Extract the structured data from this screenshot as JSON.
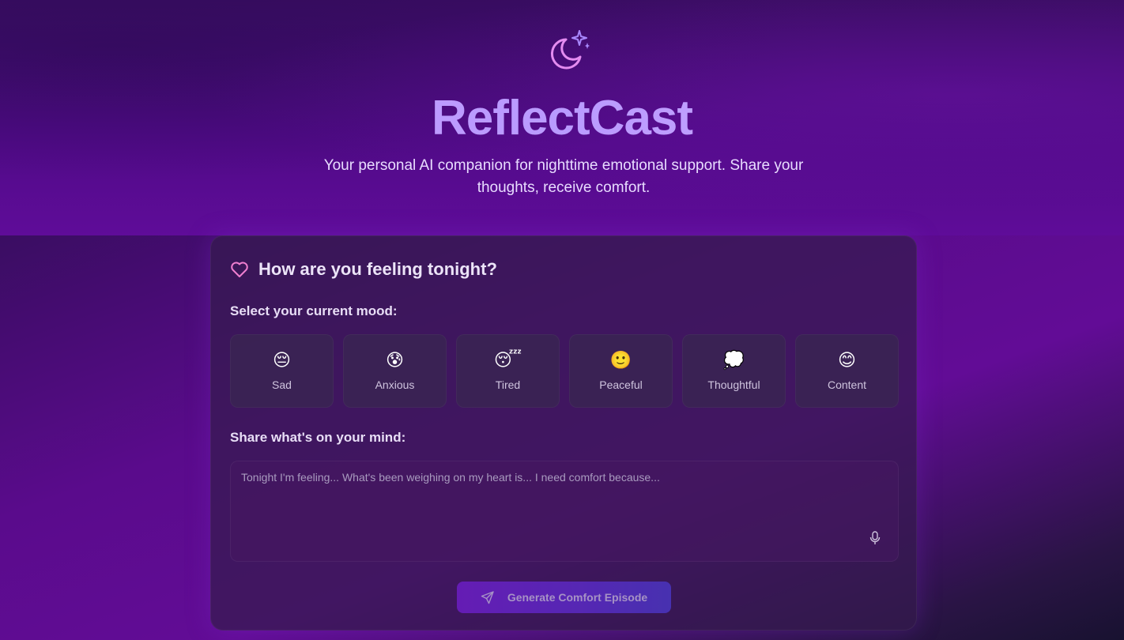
{
  "app": {
    "title": "ReflectCast",
    "subtitle": "Your personal AI companion for nighttime emotional support. Share your thoughts, receive comfort."
  },
  "card": {
    "title": "How are you feeling tonight?",
    "mood_label": "Select your current mood:",
    "moods": [
      {
        "emoji": "😔",
        "label": "Sad"
      },
      {
        "emoji": "😰",
        "label": "Anxious"
      },
      {
        "emoji": "😴",
        "label": "Tired"
      },
      {
        "emoji": "🙂",
        "label": "Peaceful"
      },
      {
        "emoji": "💭",
        "label": "Thoughtful"
      },
      {
        "emoji": "😊",
        "label": "Content"
      }
    ],
    "mind_label": "Share what's on your mind:",
    "textarea": {
      "value": "",
      "placeholder": "Tonight I'm feeling... What's been weighing on my heart is... I need comfort because..."
    },
    "generate_label": "Generate Comfort Episode"
  },
  "icons": {
    "logo": "moon-stars-icon",
    "heart": "heart-icon",
    "mic": "microphone-icon",
    "send": "send-icon"
  },
  "colors": {
    "accent": "#c79cff",
    "heart": "#f07fd0",
    "button_start": "#6c1ec4",
    "button_end": "#4a36c0"
  }
}
